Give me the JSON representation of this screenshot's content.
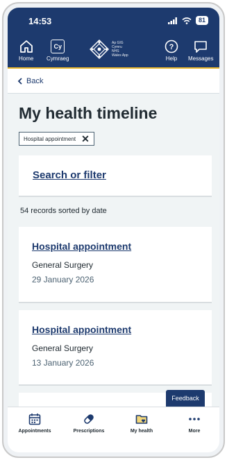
{
  "status": {
    "time": "14:53",
    "battery": "81"
  },
  "header": {
    "home_label": "Home",
    "cymraeg_label": "Cymraeg",
    "cymraeg_icon_text": "Cy",
    "logo_text_lines": [
      "Ap GIG",
      "Cymru",
      "NHS",
      "Wales App"
    ],
    "help_label": "Help",
    "messages_label": "Messages"
  },
  "back": {
    "label": "Back"
  },
  "page": {
    "title": "My health timeline"
  },
  "filter_chip": {
    "label": "Hospital appointment"
  },
  "search": {
    "label": "Search or filter"
  },
  "records_summary": "54 records sorted by date",
  "records": [
    {
      "title": "Hospital appointment",
      "specialty": "General Surgery",
      "date": "29 January 2026"
    },
    {
      "title": "Hospital appointment",
      "specialty": "General Surgery",
      "date": "13 January 2026"
    }
  ],
  "feedback": {
    "label": "Feedback"
  },
  "bottom_nav": [
    {
      "label": "Appointments",
      "icon": "calendar-icon"
    },
    {
      "label": "Prescriptions",
      "icon": "pill-icon"
    },
    {
      "label": "My health",
      "icon": "folder-heart-icon"
    },
    {
      "label": "More",
      "icon": "more-dots-icon"
    }
  ],
  "colors": {
    "brand": "#1d3a6e",
    "accent": "#e8b52b",
    "background": "#f0f4f5"
  }
}
